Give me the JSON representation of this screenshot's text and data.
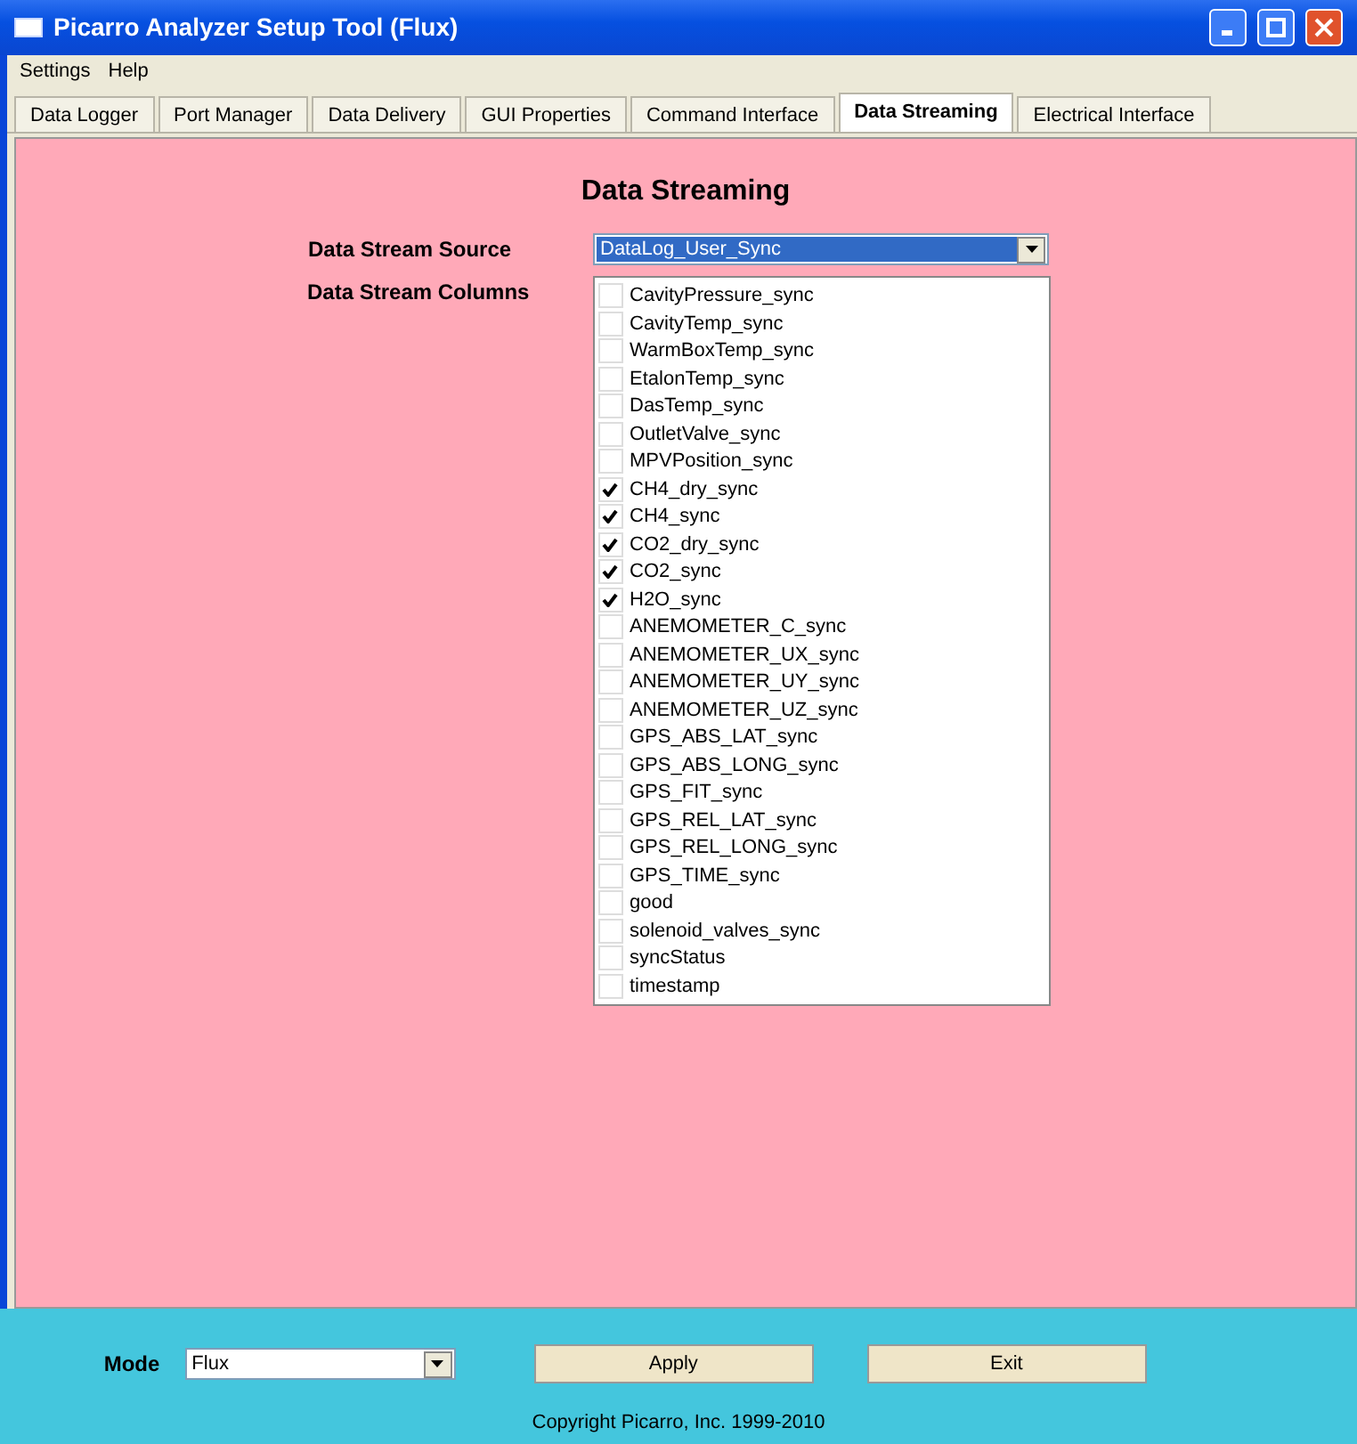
{
  "window": {
    "title": "Picarro Analyzer Setup Tool (Flux)"
  },
  "menu": [
    "Settings",
    "Help"
  ],
  "tabs": [
    {
      "label": "Data Logger",
      "selected": false
    },
    {
      "label": "Port Manager",
      "selected": false
    },
    {
      "label": "Data Delivery",
      "selected": false
    },
    {
      "label": "GUI Properties",
      "selected": false
    },
    {
      "label": "Command Interface",
      "selected": false
    },
    {
      "label": "Data Streaming",
      "selected": true
    },
    {
      "label": "Electrical Interface",
      "selected": false
    }
  ],
  "heading": "Data Streaming",
  "source": {
    "label": "Data Stream Source",
    "value": "DataLog_User_Sync"
  },
  "columns_label": "Data Stream Columns",
  "columns": [
    {
      "name": "CavityPressure_sync",
      "checked": false
    },
    {
      "name": "CavityTemp_sync",
      "checked": false
    },
    {
      "name": "WarmBoxTemp_sync",
      "checked": false
    },
    {
      "name": "EtalonTemp_sync",
      "checked": false
    },
    {
      "name": "DasTemp_sync",
      "checked": false
    },
    {
      "name": "OutletValve_sync",
      "checked": false
    },
    {
      "name": "MPVPosition_sync",
      "checked": false
    },
    {
      "name": "CH4_dry_sync",
      "checked": true
    },
    {
      "name": "CH4_sync",
      "checked": true
    },
    {
      "name": "CO2_dry_sync",
      "checked": true
    },
    {
      "name": "CO2_sync",
      "checked": true
    },
    {
      "name": "H2O_sync",
      "checked": true
    },
    {
      "name": "ANEMOMETER_C_sync",
      "checked": false
    },
    {
      "name": "ANEMOMETER_UX_sync",
      "checked": false
    },
    {
      "name": "ANEMOMETER_UY_sync",
      "checked": false
    },
    {
      "name": "ANEMOMETER_UZ_sync",
      "checked": false
    },
    {
      "name": "GPS_ABS_LAT_sync",
      "checked": false
    },
    {
      "name": "GPS_ABS_LONG_sync",
      "checked": false
    },
    {
      "name": "GPS_FIT_sync",
      "checked": false
    },
    {
      "name": "GPS_REL_LAT_sync",
      "checked": false
    },
    {
      "name": "GPS_REL_LONG_sync",
      "checked": false
    },
    {
      "name": "GPS_TIME_sync",
      "checked": false
    },
    {
      "name": "good",
      "checked": false
    },
    {
      "name": "solenoid_valves_sync",
      "checked": false
    },
    {
      "name": "syncStatus",
      "checked": false
    },
    {
      "name": "timestamp",
      "checked": false
    }
  ],
  "mode": {
    "label": "Mode",
    "value": "Flux"
  },
  "buttons": [
    "Apply",
    "Exit"
  ],
  "copyright": "Copyright Picarro, Inc. 1999-2010"
}
